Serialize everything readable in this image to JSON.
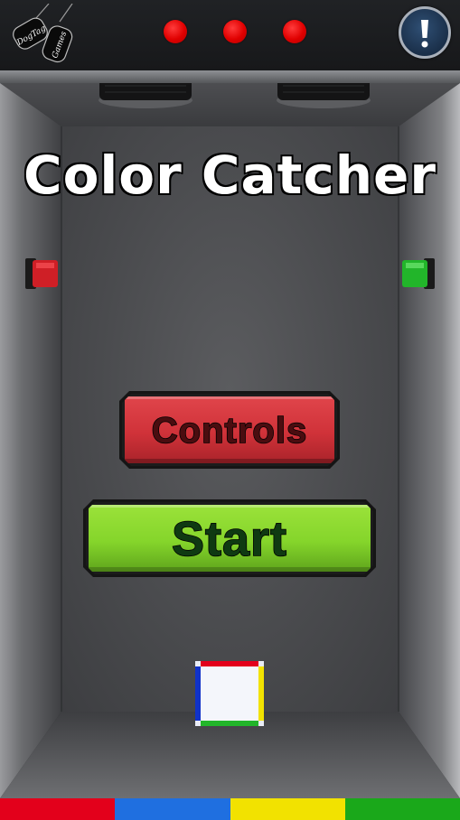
{
  "brand": {
    "logo_text_1": "DogTag",
    "logo_text_2": "Games"
  },
  "hud": {
    "lives_count": 3,
    "lives_color": "#e60000",
    "alert_icon": "exclamation-icon"
  },
  "title": "Color Catcher",
  "menu": {
    "controls_label": "Controls",
    "start_label": "Start"
  },
  "colors": {
    "red": "#e3001b",
    "blue": "#1f6fe0",
    "yellow": "#f2e200",
    "green": "#1aa81a"
  },
  "emitters": {
    "left_color": "red",
    "right_color": "green"
  },
  "color_strip": [
    "red",
    "blue",
    "yellow",
    "green"
  ],
  "player_cube": {
    "top": "red",
    "left": "blue",
    "right": "yellow",
    "bottom": "green"
  }
}
